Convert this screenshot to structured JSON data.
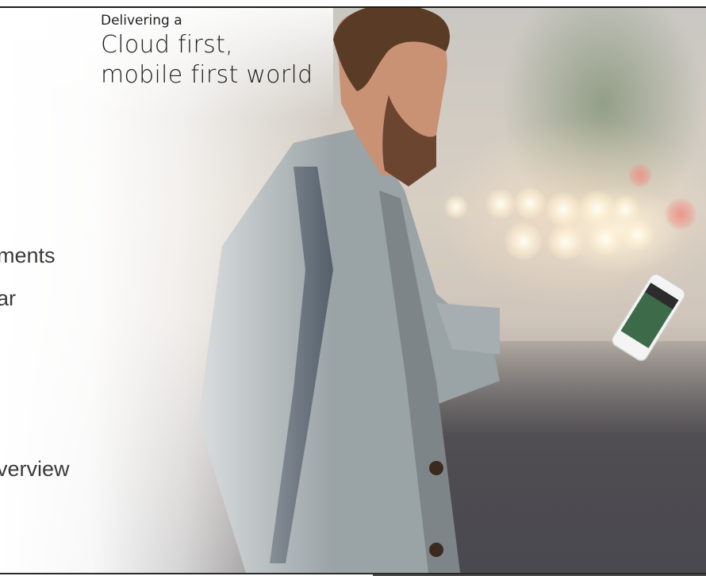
{
  "headline": {
    "kicker": "Delivering a",
    "line1": "Cloud first,",
    "line2": "mobile first world"
  },
  "agenda": {
    "items": [
      "ments",
      "ar",
      "verview"
    ]
  },
  "colors": {
    "text_dark": "#1f1f1f",
    "agenda_text": "#3a3a3a",
    "jacket": "#9aa3a6",
    "skin": "#c99274",
    "hair": "#5a3b26",
    "road": "#4a4950"
  },
  "photo": {
    "subject": "person-looking-at-phone-photo"
  }
}
